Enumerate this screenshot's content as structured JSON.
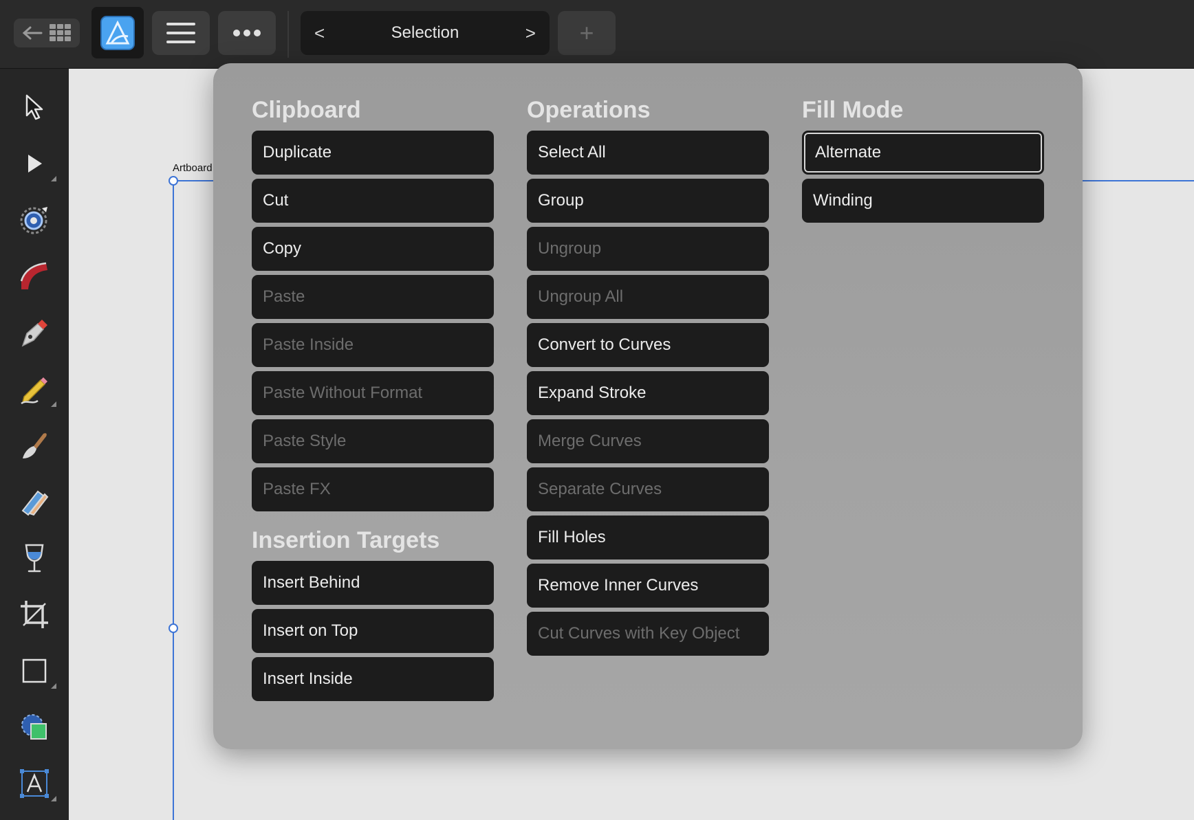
{
  "toolbar": {
    "persona_label": "Selection",
    "prev_label": "<",
    "next_label": ">",
    "add_label": "+"
  },
  "canvas": {
    "artboard_label": "Artboard"
  },
  "panel": {
    "clipboard": {
      "title": "Clipboard",
      "items": [
        {
          "label": "Duplicate",
          "enabled": true
        },
        {
          "label": "Cut",
          "enabled": true
        },
        {
          "label": "Copy",
          "enabled": true
        },
        {
          "label": "Paste",
          "enabled": false
        },
        {
          "label": "Paste Inside",
          "enabled": false
        },
        {
          "label": "Paste Without Format",
          "enabled": false
        },
        {
          "label": "Paste Style",
          "enabled": false
        },
        {
          "label": "Paste FX",
          "enabled": false
        }
      ]
    },
    "insertion_targets": {
      "title": "Insertion Targets",
      "items": [
        {
          "label": "Insert Behind",
          "enabled": true
        },
        {
          "label": "Insert on Top",
          "enabled": true
        },
        {
          "label": "Insert Inside",
          "enabled": true
        }
      ]
    },
    "operations": {
      "title": "Operations",
      "items": [
        {
          "label": "Select All",
          "enabled": true
        },
        {
          "label": "Group",
          "enabled": true
        },
        {
          "label": "Ungroup",
          "enabled": false
        },
        {
          "label": "Ungroup All",
          "enabled": false
        },
        {
          "label": "Convert to Curves",
          "enabled": true
        },
        {
          "label": "Expand Stroke",
          "enabled": true
        },
        {
          "label": "Merge Curves",
          "enabled": false
        },
        {
          "label": "Separate Curves",
          "enabled": false
        },
        {
          "label": "Fill Holes",
          "enabled": true
        },
        {
          "label": "Remove Inner Curves",
          "enabled": true
        },
        {
          "label": "Cut Curves with Key Object",
          "enabled": false
        }
      ]
    },
    "fill_mode": {
      "title": "Fill Mode",
      "selected": "Alternate",
      "items": [
        {
          "label": "Alternate",
          "enabled": true
        },
        {
          "label": "Winding",
          "enabled": true
        }
      ]
    }
  },
  "tools": [
    "move-tool-icon",
    "node-tool-icon",
    "corner-tool-icon",
    "pencil-tool-icon",
    "pen-tool-icon",
    "vector-brush-tool-icon",
    "brush-tool-icon",
    "fill-tool-icon",
    "transparency-tool-icon",
    "crop-tool-icon",
    "rectangle-tool-icon",
    "shape-tool-icon",
    "text-tool-icon"
  ],
  "colors": {
    "accent_blue": "#3d74d6",
    "app_icon_blue": "#4aa3f0",
    "button_bg": "#1c1c1c",
    "panel_bg": "#9b9b9b"
  }
}
